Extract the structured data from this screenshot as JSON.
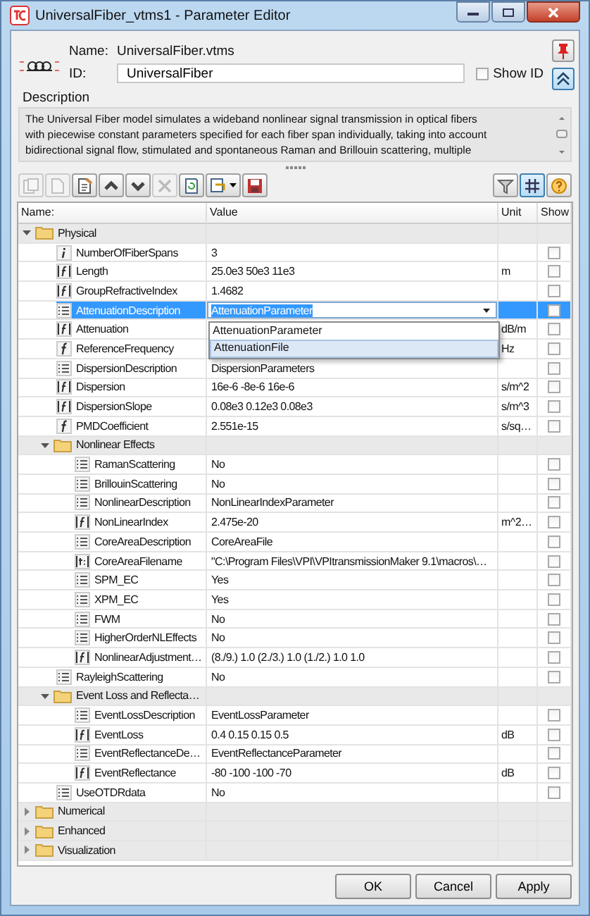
{
  "window": {
    "title": "UniversalFiber_vtms1 - Parameter Editor"
  },
  "header": {
    "name_label": "Name:",
    "name_value": "UniversalFiber.vtms",
    "id_label": "ID:",
    "id_value": "UniversalFiber",
    "show_id": {
      "label": "Show ID",
      "checked": false
    }
  },
  "description": {
    "label": "Description",
    "lines": [
      "The Universal Fiber model simulates a wideband nonlinear signal transmission  in optical fibers",
      "with piecewise constant parameters specified for each fiber  span individually, taking into account",
      "bidirectional signal flow, stimulated  and spontaneous Raman and Brillouin scattering, multiple"
    ]
  },
  "toolbar": {
    "left": [
      {
        "kind": "copy",
        "disabled": true
      },
      {
        "kind": "new",
        "disabled": true
      },
      {
        "kind": "properties",
        "disabled": false
      },
      {
        "kind": "up",
        "disabled": false
      },
      {
        "kind": "down",
        "disabled": false
      },
      {
        "kind": "delete",
        "disabled": true
      },
      {
        "kind": "refresh",
        "disabled": false
      },
      {
        "kind": "export",
        "disabled": false
      },
      {
        "kind": "save",
        "disabled": false
      }
    ],
    "right": [
      {
        "kind": "filter",
        "pressed": false
      },
      {
        "kind": "grid",
        "pressed": true
      },
      {
        "kind": "help",
        "pressed": false
      }
    ]
  },
  "table": {
    "columns": [
      "Name:",
      "Value",
      "Unit",
      "Show"
    ],
    "tree": [
      {
        "name": "Physical",
        "expanded": true,
        "children": [
          {
            "kind": "int",
            "name": "NumberOfFiberSpans",
            "value": "3",
            "show": false,
            "selected": false
          },
          {
            "kind": "float",
            "name": "Length",
            "value": "25.0e3 50e3 11e3",
            "unit": "m",
            "show": false,
            "selected": false
          },
          {
            "kind": "float",
            "name": "GroupRefractiveIndex",
            "value": "1.4682",
            "show": false,
            "selected": false
          },
          {
            "kind": "enum",
            "name": "AttenuationDescription",
            "value": "AttenuationParameter",
            "show": false,
            "selected": true
          },
          {
            "kind": "float",
            "name": "Attenuation",
            "unit": "dB/m",
            "show": false,
            "selected": false
          },
          {
            "kind": "real",
            "name": "ReferenceFrequency",
            "unit": "Hz",
            "show": false,
            "selected": false
          },
          {
            "kind": "enum",
            "name": "DispersionDescription",
            "value": "DispersionParameters",
            "show": false,
            "selected": false
          },
          {
            "kind": "float",
            "name": "Dispersion",
            "value": "16e-6 -8e-6 16e-6",
            "unit": "s/m^2",
            "show": false,
            "selected": false
          },
          {
            "kind": "float",
            "name": "DispersionSlope",
            "value": "0.08e3 0.12e3 0.08e3",
            "unit": "s/m^3",
            "show": false,
            "selected": false
          },
          {
            "kind": "real",
            "name": "PMDCoefficient",
            "value": "2.551e-15",
            "unit": "s/sq…",
            "show": false,
            "selected": false
          },
          {
            "name": "Nonlinear Effects",
            "expanded": true,
            "children": [
              {
                "kind": "enum",
                "name": "RamanScattering",
                "value": "No",
                "show": false,
                "selected": false
              },
              {
                "kind": "enum",
                "name": "BrillouinScattering",
                "value": "No",
                "show": false,
                "selected": false
              },
              {
                "kind": "enum",
                "name": "NonlinearDescription",
                "value": "NonLinearIndexParameter",
                "show": false,
                "selected": false
              },
              {
                "kind": "float",
                "name": "NonLinearIndex",
                "value": "2.475e-20",
                "unit": "m^2…",
                "show": false,
                "selected": false
              },
              {
                "kind": "enum",
                "name": "CoreAreaDescription",
                "value": "CoreAreaFile",
                "show": false,
                "selected": false
              },
              {
                "kind": "text",
                "name": "CoreAreaFilename",
                "value": "\"C:\\Program Files\\VPI\\VPItransmissionMaker 9.1\\macros\\…",
                "show": false,
                "selected": false
              },
              {
                "kind": "enum",
                "name": "SPM_EC",
                "value": "Yes",
                "show": false,
                "selected": false
              },
              {
                "kind": "enum",
                "name": "XPM_EC",
                "value": "Yes",
                "show": false,
                "selected": false
              },
              {
                "kind": "enum",
                "name": "FWM",
                "value": "No",
                "show": false,
                "selected": false
              },
              {
                "kind": "enum",
                "name": "HigherOrderNLEffects",
                "value": "No",
                "show": false,
                "selected": false
              },
              {
                "kind": "float",
                "name": "NonlinearAdjustment…",
                "value": "(8./9.) 1.0 (2./3.) 1.0 (1./2.) 1.0 1.0",
                "show": false,
                "selected": false
              }
            ]
          },
          {
            "kind": "enum",
            "name": "RayleighScattering",
            "value": "No",
            "show": false,
            "selected": false
          },
          {
            "name": "Event Loss and Reflecta…",
            "expanded": true,
            "children": [
              {
                "kind": "enum",
                "name": "EventLossDescription",
                "value": "EventLossParameter",
                "show": false,
                "selected": false
              },
              {
                "kind": "float",
                "name": "EventLoss",
                "value": "0.4 0.15  0.15  0.5",
                "unit": "dB",
                "show": false,
                "selected": false
              },
              {
                "kind": "enum",
                "name": "EventReflectanceDe…",
                "value": "EventReflectanceParameter",
                "show": false,
                "selected": false
              },
              {
                "kind": "float",
                "name": "EventReflectance",
                "value": "-80 -100 -100 -70",
                "unit": "dB",
                "show": false,
                "selected": false
              }
            ]
          },
          {
            "kind": "enum",
            "name": "UseOTDRdata",
            "value": "No",
            "show": false,
            "selected": false
          }
        ]
      },
      {
        "name": "Numerical",
        "expanded": false
      },
      {
        "name": "Enhanced",
        "expanded": false
      },
      {
        "name": "Visualization",
        "expanded": false
      }
    ]
  },
  "dropdown": {
    "options": [
      {
        "label": "AttenuationParameter",
        "selected": false
      },
      {
        "label": "AttenuationFile",
        "selected": true
      }
    ]
  },
  "buttons": [
    "OK",
    "Cancel",
    "Apply"
  ]
}
